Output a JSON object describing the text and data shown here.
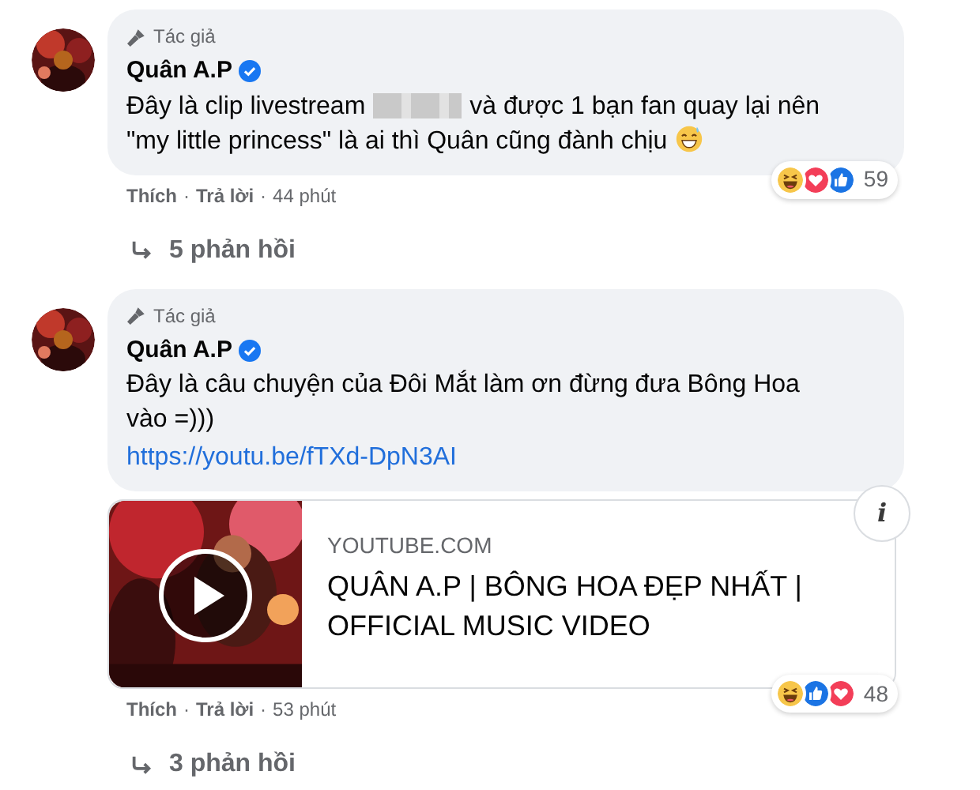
{
  "comments": [
    {
      "badge": "Tác giả",
      "author": "Quân A.P",
      "verified": true,
      "body": [
        {
          "kind": "text",
          "text": "Đây là clip livestream"
        },
        {
          "kind": "redacted"
        },
        {
          "kind": "text",
          "text": "và được 1 bạn fan quay lại nên \"my little princess\" là ai thì Quân cũng đành chịu"
        },
        {
          "kind": "emoji"
        }
      ],
      "footer": [
        {
          "kind": "action",
          "text": "Thích"
        },
        {
          "kind": "separator",
          "text": "·"
        },
        {
          "kind": "action",
          "text": "Trả lời"
        },
        {
          "kind": "separator",
          "text": "·"
        },
        {
          "kind": "time",
          "text": "44 phút"
        }
      ],
      "reactions": [
        {
          "kind": "haha"
        },
        {
          "kind": "love"
        },
        {
          "kind": "like"
        }
      ],
      "reaction_count": "59",
      "replies": "5 phản hồi"
    },
    {
      "badge": "Tác giả",
      "author": "Quân A.P",
      "verified": true,
      "body": [
        {
          "kind": "text",
          "text": "Đây là câu chuyện của Đôi Mắt làm ơn đừng đưa Bông Hoa vào =)))"
        }
      ],
      "link": "https://youtu.be/fTXd-DpN3AI",
      "preview": {
        "kind": "picture",
        "domain": "YOUTUBE.COM",
        "title": "QUÂN A.P | BÔNG HOA ĐẸP NHẤT | OFFICIAL MUSIC VIDEO",
        "info": "i"
      },
      "footer": [
        {
          "kind": "action",
          "text": "Thích"
        },
        {
          "kind": "separator",
          "text": "·"
        },
        {
          "kind": "action",
          "text": "Trả lời"
        },
        {
          "kind": "separator",
          "text": "·"
        },
        {
          "kind": "time",
          "text": "53 phút"
        }
      ],
      "reactions": [
        {
          "kind": "haha"
        },
        {
          "kind": "like"
        },
        {
          "kind": "love"
        }
      ],
      "reaction_count": "48",
      "replies": "3 phản hồi"
    }
  ]
}
